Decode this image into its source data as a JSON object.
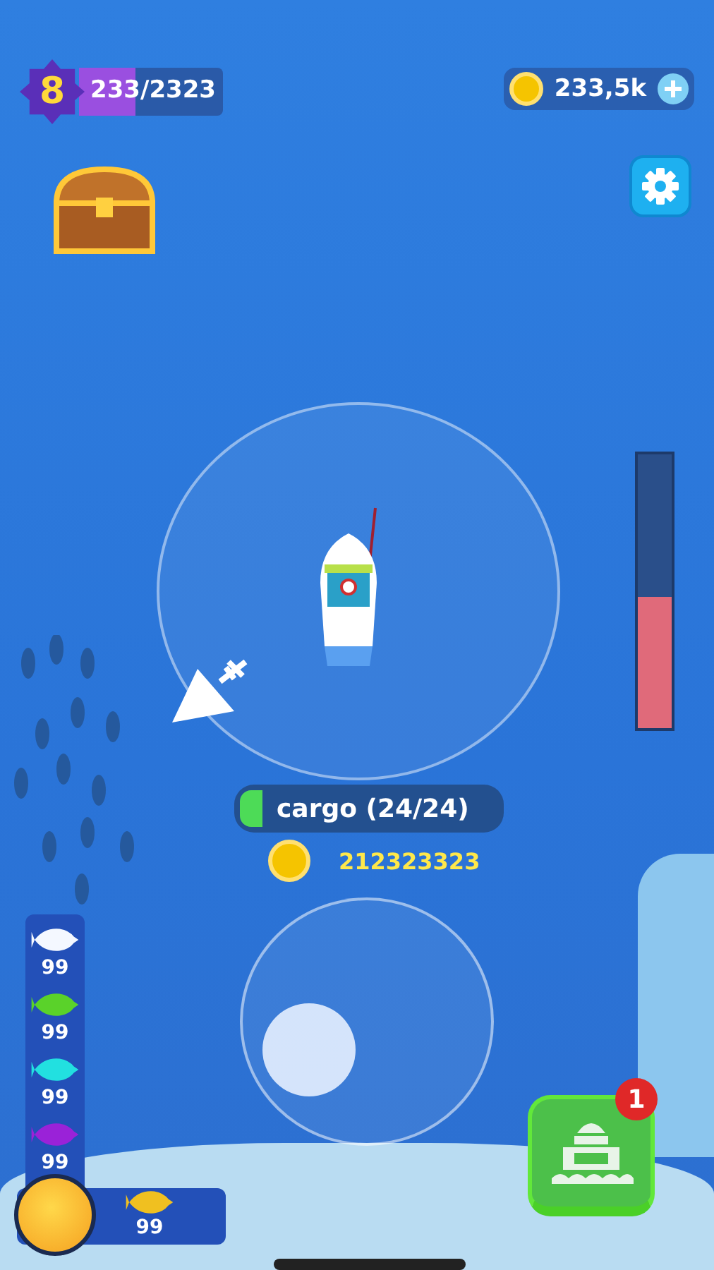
{
  "player_level": {
    "number": "8",
    "progress": "233/2323",
    "level": 0.39
  },
  "coins": {
    "amount": "233,5k"
  },
  "cargo": {
    "label": "cargo (24/24)"
  },
  "earnings": {
    "amount": "212323323"
  },
  "depth_meter": {
    "level": 0.48
  },
  "fish_inventory": [
    {
      "color": "#f4f8ff",
      "count": "99"
    },
    {
      "color": "#5ad22a",
      "count": "99"
    },
    {
      "color": "#22e0e0",
      "count": "99"
    },
    {
      "color": "#9a22d8",
      "count": "99"
    }
  ],
  "catch_slot": {
    "color": "#f0c020",
    "count": "99"
  },
  "harbor_button": {
    "badge": "1"
  }
}
